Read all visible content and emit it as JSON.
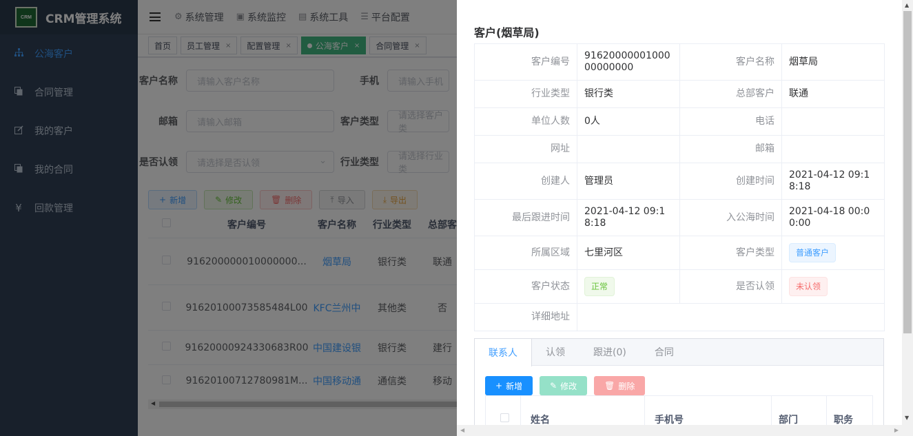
{
  "app": {
    "title": "CRM管理系统",
    "logo_text": "CRM"
  },
  "sidebar": {
    "items": [
      {
        "label": "公海客户",
        "icon": "sitemap-icon",
        "active": true
      },
      {
        "label": "合同管理",
        "icon": "copy-icon"
      },
      {
        "label": "我的客户",
        "icon": "edit-icon"
      },
      {
        "label": "我的合同",
        "icon": "copy-icon"
      },
      {
        "label": "回款管理",
        "icon": "yen-icon"
      }
    ]
  },
  "topmenu": [
    {
      "label": "系统管理",
      "icon": "gear-icon"
    },
    {
      "label": "系统监控",
      "icon": "monitor-icon"
    },
    {
      "label": "系统工具",
      "icon": "toolbox-icon"
    },
    {
      "label": "平台配置",
      "icon": "list-icon"
    }
  ],
  "tags": [
    {
      "label": "首页",
      "closable": false
    },
    {
      "label": "员工管理",
      "closable": true
    },
    {
      "label": "配置管理",
      "closable": true
    },
    {
      "label": "公海客户",
      "closable": true,
      "active": true
    },
    {
      "label": "合同管理",
      "closable": true
    }
  ],
  "filters": {
    "customer_name": {
      "label": "客户名称",
      "placeholder": "请输入客户名称"
    },
    "phone": {
      "label": "手机",
      "placeholder": "请输入手机"
    },
    "email": {
      "label": "邮箱",
      "placeholder": "请输入邮箱"
    },
    "customer_type": {
      "label": "客户类型",
      "placeholder": "请选择客户类"
    },
    "claimed": {
      "label": "是否认领",
      "placeholder": "请选择是否认领"
    },
    "industry": {
      "label": "行业类型",
      "placeholder": "请选择行业类"
    }
  },
  "toolbar": {
    "add": "新增",
    "edit": "修改",
    "delete": "删除",
    "import": "导入",
    "export": "导出"
  },
  "table": {
    "headers": [
      "客户编号",
      "客户名称",
      "行业类型",
      "总部客"
    ],
    "rows": [
      {
        "code": "916200000010000000...",
        "name": "烟草局",
        "industry": "银行类",
        "hq": "联通"
      },
      {
        "code": "91620100073585484L00",
        "name": "KFC兰州中",
        "industry": "其他类",
        "hq": "否"
      },
      {
        "code": "91620000924330683R00",
        "name": "中国建设银",
        "industry": "银行类",
        "hq": "建行"
      },
      {
        "code": "91620100712780981M...",
        "name": "中国移动通",
        "industry": "通信类",
        "hq": "移动"
      }
    ]
  },
  "drawer": {
    "title": "客户(烟草局)",
    "fields": {
      "code_label": "客户编号",
      "code": "9162000000100000000000",
      "name_label": "客户名称",
      "name": "烟草局",
      "industry_label": "行业类型",
      "industry": "银行类",
      "hq_label": "总部客户",
      "hq": "联通",
      "staff_label": "单位人数",
      "staff": "0人",
      "phone_label": "电话",
      "phone": "",
      "website_label": "网址",
      "website": "",
      "email_label": "邮箱",
      "email": "",
      "creator_label": "创建人",
      "creator": "管理员",
      "created_label": "创建时间",
      "created": "2021-04-12 09:18:18",
      "last_follow_label": "最后跟进时间",
      "last_follow": "2021-04-12 09:18:18",
      "pool_time_label": "入公海时间",
      "pool_time": "2021-04-18 00:00:00",
      "region_label": "所属区域",
      "region": "七里河区",
      "type_label": "客户类型",
      "type": "普通客户",
      "status_label": "客户状态",
      "status": "正常",
      "claimed_label": "是否认领",
      "claimed": "未认领",
      "address_label": "详细地址",
      "address": ""
    },
    "tabs": [
      "联系人",
      "认领",
      "跟进(0)",
      "合同"
    ],
    "contact_buttons": {
      "add": "新增",
      "edit": "修改",
      "delete": "删除"
    },
    "contact_headers": [
      "姓名",
      "手机号",
      "部门",
      "职务"
    ]
  },
  "colors": {
    "sidebar_bg": "#304156",
    "active": "#409eff",
    "tag_active": "#42b983"
  }
}
